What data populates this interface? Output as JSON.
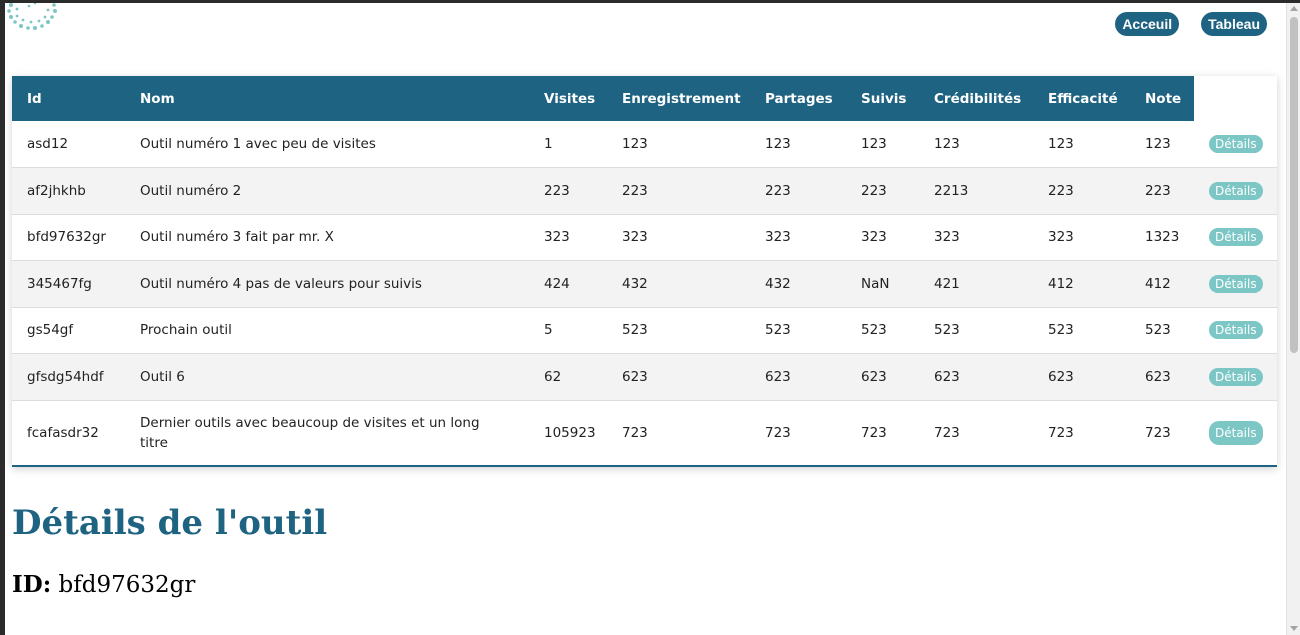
{
  "nav": {
    "home_label": "Acceuil",
    "table_label": "Tableau"
  },
  "table": {
    "headers": [
      "Id",
      "Nom",
      "Visites",
      "Enregistrement",
      "Partages",
      "Suivis",
      "Crédibilités",
      "Efficacité",
      "Note"
    ],
    "details_label": "Détails",
    "rows": [
      [
        "asd12",
        "Outil numéro 1 avec peu de visites",
        "1",
        "123",
        "123",
        "123",
        "123",
        "123",
        "123"
      ],
      [
        "af2jhkhb",
        "Outil numéro 2",
        "223",
        "223",
        "223",
        "223",
        "2213",
        "223",
        "223"
      ],
      [
        "bfd97632gr",
        "Outil numéro 3 fait par mr. X",
        "323",
        "323",
        "323",
        "323",
        "323",
        "323",
        "1323"
      ],
      [
        "345467fg",
        "Outil numéro 4 pas de valeurs pour suivis",
        "424",
        "432",
        "432",
        "NaN",
        "421",
        "412",
        "412"
      ],
      [
        "gs54gf",
        "Prochain outil",
        "5",
        "523",
        "523",
        "523",
        "523",
        "523",
        "523"
      ],
      [
        "gfsdg54hdf",
        "Outil 6",
        "62",
        "623",
        "623",
        "623",
        "623",
        "623",
        "623"
      ],
      [
        "fcafasdr32",
        "Dernier outils avec beaucoup de visites et un long titre",
        "105923",
        "723",
        "723",
        "723",
        "723",
        "723",
        "723"
      ]
    ]
  },
  "details": {
    "title": "Détails de l'outil",
    "id_label": "ID:",
    "id_value": "bfd97632gr"
  },
  "colors": {
    "primary": "#1f6382",
    "accent": "#7cc7c6"
  }
}
